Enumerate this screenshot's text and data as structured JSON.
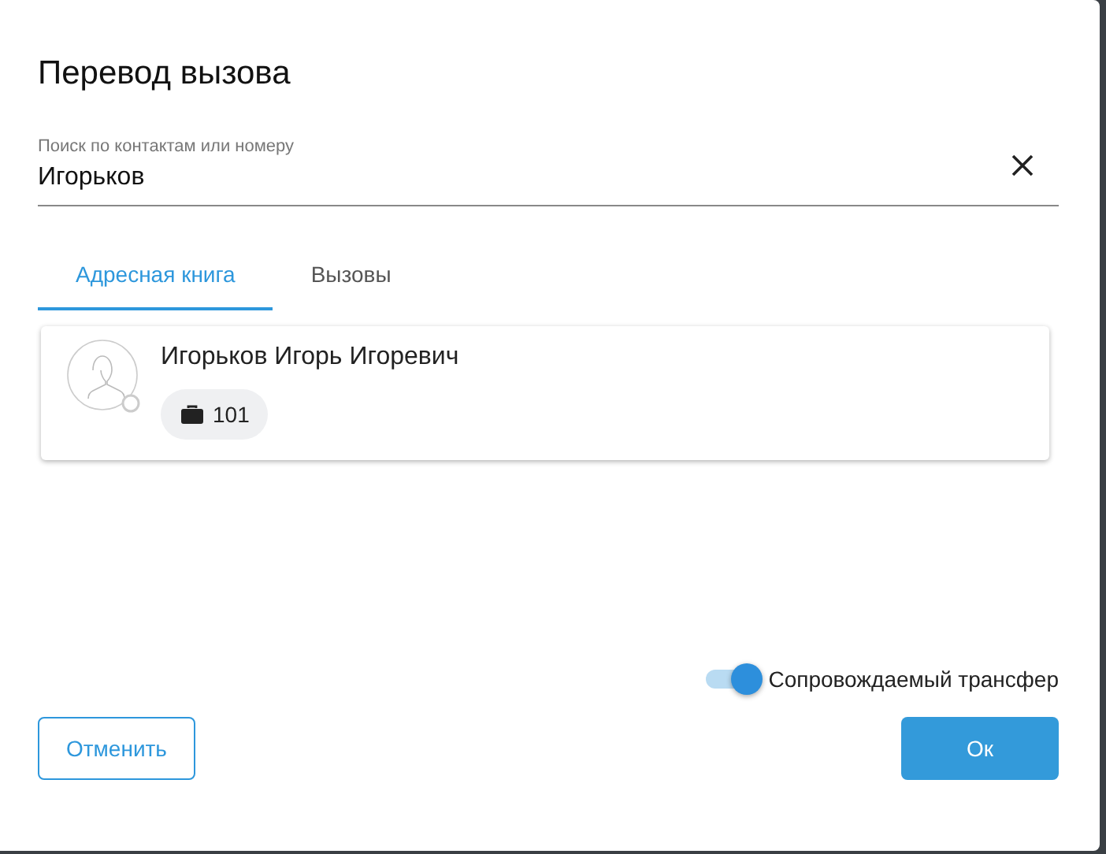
{
  "dialog": {
    "title": "Перевод вызова"
  },
  "search": {
    "label": "Поиск по контактам или номеру",
    "value": "Игорьков"
  },
  "tabs": [
    {
      "label": "Адресная книга",
      "selected": true
    },
    {
      "label": "Вызовы",
      "selected": false
    }
  ],
  "contacts": [
    {
      "name": "Игорьков Игорь Игоревич",
      "extension": "101"
    }
  ],
  "attended_transfer": {
    "label": "Сопровождаемый трансфер",
    "on": true
  },
  "buttons": {
    "cancel": "Отменить",
    "ok": "Ок"
  }
}
